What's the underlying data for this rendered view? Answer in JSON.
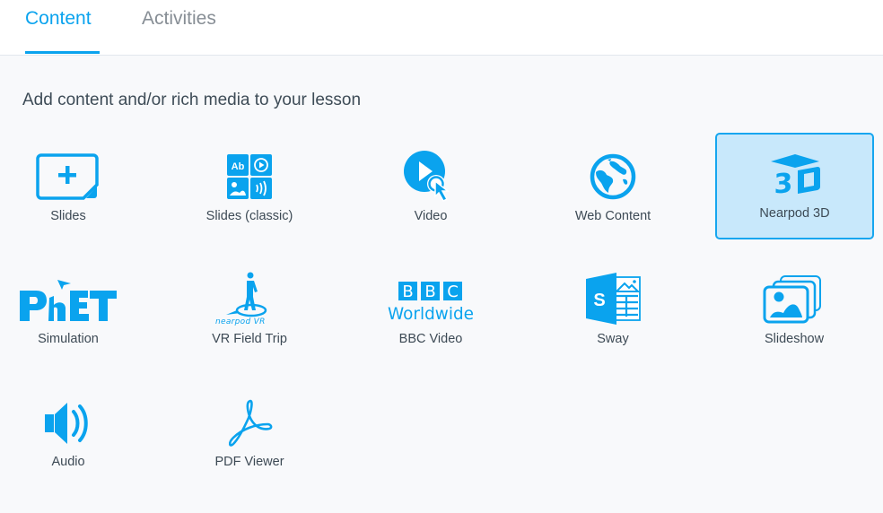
{
  "tabs": [
    {
      "label": "Content",
      "active": true
    },
    {
      "label": "Activities",
      "active": false
    }
  ],
  "heading": "Add content and/or rich media to your lesson",
  "accent_color": "#0aa3ee",
  "selected_tile_bg": "#c8e8fb",
  "items": [
    {
      "label": "Slides",
      "icon": "slides-add-icon",
      "selected": false
    },
    {
      "label": "Slides (classic)",
      "icon": "slides-classic-grid-icon",
      "selected": false,
      "icon_text": "Ab"
    },
    {
      "label": "Video",
      "icon": "video-play-cursor-icon",
      "selected": false
    },
    {
      "label": "Web Content",
      "icon": "globe-icon",
      "selected": false
    },
    {
      "label": "Nearpod 3D",
      "icon": "nearpod-3d-icon",
      "selected": true,
      "icon_text": "3D"
    },
    {
      "label": "Simulation",
      "icon": "phet-logo-icon",
      "selected": false,
      "icon_text": "PhET"
    },
    {
      "label": "VR Field Trip",
      "icon": "nearpod-vr-walker-icon",
      "selected": false,
      "icon_text": "nearpod VR"
    },
    {
      "label": "BBC Video",
      "icon": "bbc-worldwide-logo-icon",
      "selected": false,
      "icon_text": [
        "B",
        "B",
        "C",
        "Worldwide"
      ]
    },
    {
      "label": "Sway",
      "icon": "sway-logo-icon",
      "selected": false,
      "icon_text": "S"
    },
    {
      "label": "Slideshow",
      "icon": "slideshow-images-icon",
      "selected": false
    },
    {
      "label": "Audio",
      "icon": "speaker-icon",
      "selected": false
    },
    {
      "label": "PDF Viewer",
      "icon": "acrobat-pdf-icon",
      "selected": false
    }
  ]
}
